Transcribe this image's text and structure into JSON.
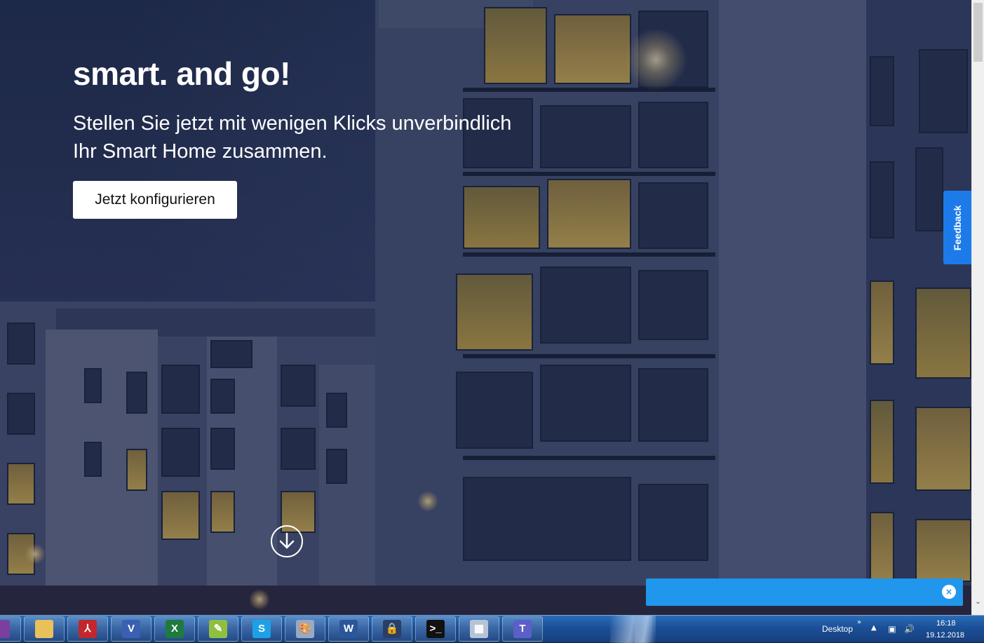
{
  "hero": {
    "title": "smart. and go!",
    "subtitle": "Stellen Sie jetzt mit wenigen Klicks unverbindlich Ihr Smart Home zusammen.",
    "cta_label": "Jetzt konfigurieren"
  },
  "feedback": {
    "label": "Feedback"
  },
  "chat": {
    "close_glyph": "×"
  },
  "scrollbar": {
    "down_arrow": "⌄"
  },
  "taskbar": {
    "apps": [
      {
        "name": "onenote",
        "icon": "onenote-icon",
        "glyph": "",
        "color": "#7b3fa0"
      },
      {
        "name": "file-explorer",
        "icon": "folder-icon",
        "glyph": "",
        "color": "#e8c15a"
      },
      {
        "name": "acrobat",
        "icon": "acrobat-icon",
        "glyph": "⅄",
        "color": "#c1272d"
      },
      {
        "name": "visio",
        "icon": "visio-icon",
        "glyph": "V",
        "color": "#3b5fb3"
      },
      {
        "name": "excel",
        "icon": "excel-icon",
        "glyph": "X",
        "color": "#1f7a3f"
      },
      {
        "name": "notepad-plus",
        "icon": "notepad-icon",
        "glyph": "✎",
        "color": "#8fbf3f"
      },
      {
        "name": "skype",
        "icon": "skype-icon",
        "glyph": "S",
        "color": "#1ea0e6"
      },
      {
        "name": "paint",
        "icon": "paint-icon",
        "glyph": "🎨",
        "color": "#9aa9c2"
      },
      {
        "name": "word",
        "icon": "word-icon",
        "glyph": "W",
        "color": "#2b579a"
      },
      {
        "name": "keepass",
        "icon": "lock-icon",
        "glyph": "🔒",
        "color": "#2c3e66"
      },
      {
        "name": "command-prompt",
        "icon": "terminal-icon",
        "glyph": ">_",
        "color": "#111111"
      },
      {
        "name": "calculator",
        "icon": "calculator-icon",
        "glyph": "▦",
        "color": "#b8c4d6"
      },
      {
        "name": "teams",
        "icon": "teams-icon",
        "glyph": "T",
        "color": "#5b5fc7"
      }
    ],
    "tray": {
      "desktop_label": "Desktop",
      "expand_glyph": "»",
      "show_hidden_glyph": "▲",
      "network_glyph": "▣",
      "volume_glyph": "🔊",
      "time": "16:18",
      "date": "19.12.2018"
    }
  }
}
